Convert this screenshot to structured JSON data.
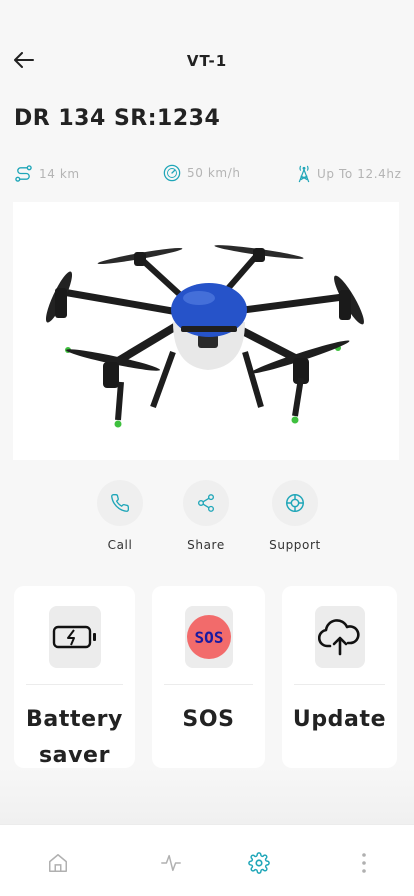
{
  "header": {
    "title": "VT-1",
    "back_icon": "arrow-left-icon"
  },
  "model": "DR 134 SR:1234",
  "stats": [
    {
      "icon": "route-icon",
      "value": "14 km"
    },
    {
      "icon": "speedometer-icon",
      "value": "50 km/h"
    },
    {
      "icon": "signal-tower-icon",
      "value": "Up To 12.4hz"
    }
  ],
  "colors": {
    "accent": "#1fa6b8",
    "sos": "#f26b6b",
    "sos_text": "#1a1aa0",
    "drone_blue": "#2653c9"
  },
  "actions": [
    {
      "icon": "phone-icon",
      "label": "Call"
    },
    {
      "icon": "share-icon",
      "label": "Share"
    },
    {
      "icon": "lifebuoy-icon",
      "label": "Support"
    }
  ],
  "cards": [
    {
      "icon": "battery-charging-icon",
      "label": "Battery saver"
    },
    {
      "icon": "sos-icon",
      "icon_text": "SOS",
      "label": "SOS"
    },
    {
      "icon": "cloud-upload-icon",
      "label": "Update"
    }
  ],
  "nav": [
    {
      "icon": "home-icon",
      "active": false
    },
    {
      "icon": "activity-icon",
      "active": false
    },
    {
      "icon": "gear-icon",
      "active": true
    },
    {
      "icon": "more-vertical-icon",
      "active": false
    }
  ]
}
